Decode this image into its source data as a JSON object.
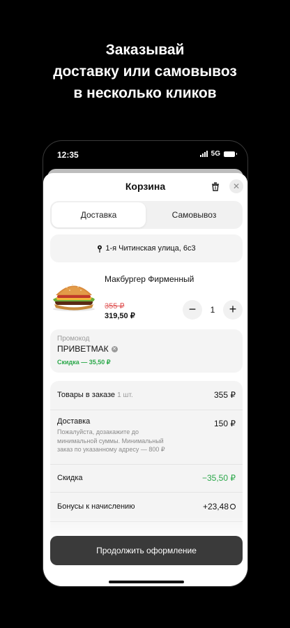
{
  "promo": {
    "line1": "Заказывай",
    "line2": "доставку или самовывоз",
    "line3": "в несколько кликов"
  },
  "status_bar": {
    "time": "12:35",
    "network": "5G"
  },
  "cart": {
    "title": "Корзина",
    "icons": {
      "trash": "trash-icon",
      "close": "close-icon"
    },
    "tabs": [
      {
        "label": "Доставка",
        "active": true
      },
      {
        "label": "Самовывоз",
        "active": false
      }
    ],
    "address": "1-я Читинская улица, 6с3",
    "item": {
      "name": "Макбургер Фирменный",
      "old_price": "355 ₽",
      "price": "319,50 ₽",
      "quantity": "1",
      "minus": "−",
      "plus": "+"
    },
    "promocode": {
      "label": "Промокод",
      "value": "ПРИВЕТМАК",
      "discount": "Скидка — 35,50 ₽"
    },
    "summary": {
      "items_label": "Товары в заказе",
      "items_count": "1 шт.",
      "items_value": "355 ₽",
      "delivery_label": "Доставка",
      "delivery_note": "Пожалуйста, дозакажите до минимальной суммы. Минимальный заказ по указанному адресу — 800 ₽",
      "delivery_value": "150 ₽",
      "discount_label": "Скидка",
      "discount_value": "−35,50 ₽",
      "bonus_label": "Бонусы к начислению",
      "bonus_value": "+23,48"
    },
    "continue_button": "Продолжить оформление"
  },
  "colors": {
    "accent_green": "#2ba84a",
    "old_price_red": "#e05656",
    "button_dark": "#3a3a3a"
  }
}
